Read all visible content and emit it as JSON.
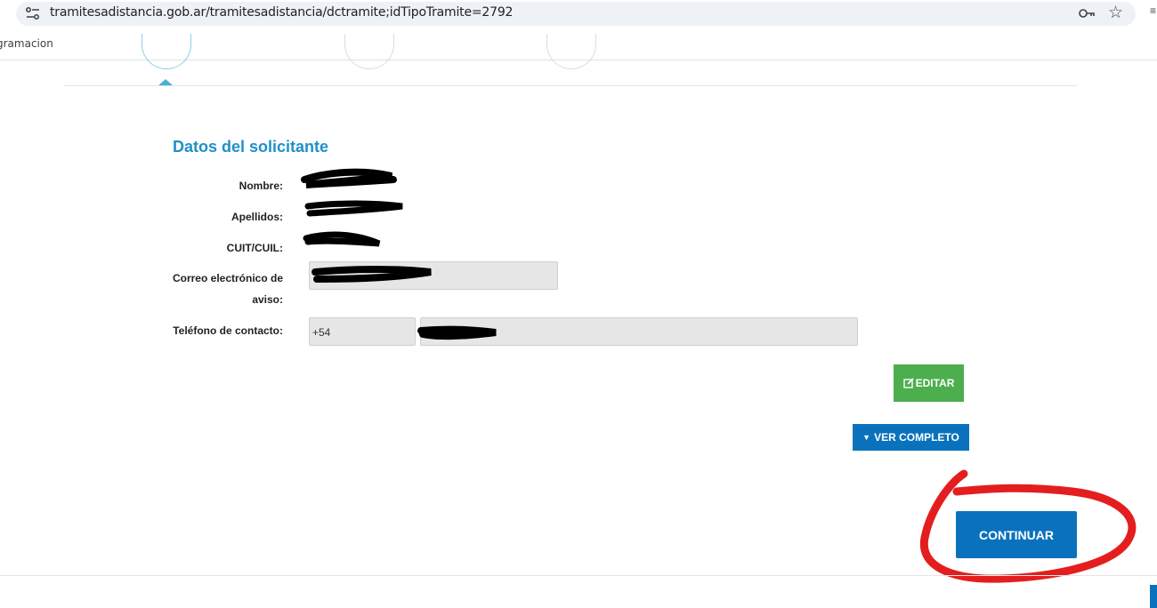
{
  "browser": {
    "url": "tramitesadistancia.gob.ar/tramitesadistancia/dctramite;idTipoTramite=2792",
    "bookmark": "gramacion"
  },
  "form": {
    "title": "Datos del solicitante",
    "labels": {
      "nombre": "Nombre:",
      "apellidos": "Apellidos:",
      "cuit": "CUIT/CUIL:",
      "correo_line1": "Correo electrónico de",
      "correo_line2": "aviso:",
      "telefono": "Teléfono de contacto:"
    },
    "phone_prefix": "+54"
  },
  "buttons": {
    "editar": "EDITAR",
    "ver_completo": "VER COMPLETO",
    "continuar": "CONTINUAR"
  },
  "colors": {
    "accent": "#1e90c8",
    "primary_button": "#0a72bd",
    "edit_button": "#4cae4c",
    "annotation_red": "#e41e1e",
    "redaction": "#000000"
  }
}
